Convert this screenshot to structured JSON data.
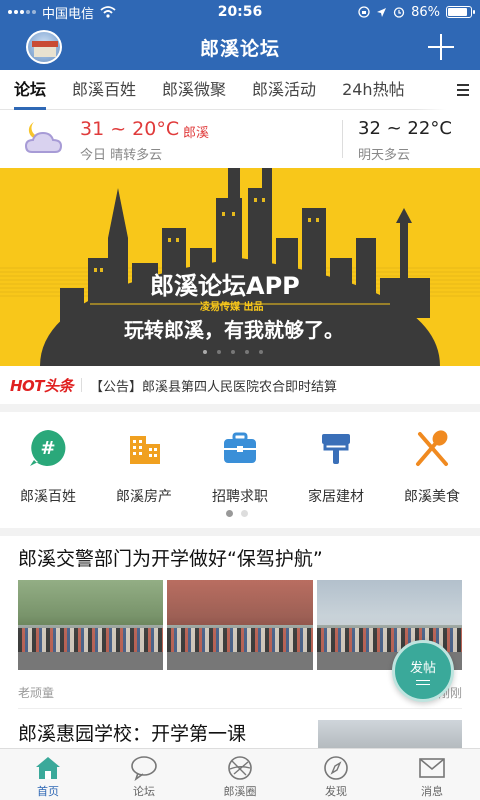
{
  "status_bar": {
    "carrier": "中国电信",
    "time": "20:56",
    "battery": "86%",
    "battery_level": 0.86
  },
  "header": {
    "title": "郎溪论坛"
  },
  "tabs": [
    "论坛",
    "郎溪百姓",
    "郎溪微聚",
    "郎溪活动",
    "24h热帖"
  ],
  "weather": {
    "today_temp": "31 ~ 20°C",
    "city": "郎溪",
    "today_desc": "今日 晴转多云",
    "tomorrow_temp": "32 ~ 22°C",
    "tomorrow_desc": "明天多云"
  },
  "banner": {
    "title": "郎溪论坛APP",
    "subtitle": "凌易传媒 出品",
    "slogan": "玩转郎溪，有我就够了。"
  },
  "headline": {
    "logo_text": "HOT头条",
    "text": "【公告】郎溪县第四人民医院农合即时结算"
  },
  "categories": [
    {
      "label": "郎溪百姓",
      "icon": "hashtag-icon",
      "color": "#2aa87a"
    },
    {
      "label": "郎溪房产",
      "icon": "building-icon",
      "color": "#f0a020"
    },
    {
      "label": "招聘求职",
      "icon": "briefcase-icon",
      "color": "#3a8fd8"
    },
    {
      "label": "家居建材",
      "icon": "brush-icon",
      "color": "#3a6fb8"
    },
    {
      "label": "郎溪美食",
      "icon": "utensils-icon",
      "color": "#f08a20"
    }
  ],
  "feed": {
    "post1": {
      "title": "郎溪交警部门为开学做好“保驾护航”",
      "author": "老顽童",
      "time": "刚刚"
    },
    "post2": {
      "title": "郎溪惠园学校：开学第一课"
    }
  },
  "fab": {
    "label": "发帖"
  },
  "bottom_nav": [
    {
      "label": "首页",
      "icon": "home-icon"
    },
    {
      "label": "论坛",
      "icon": "chat-bubble-icon"
    },
    {
      "label": "郎溪圈",
      "icon": "aperture-icon"
    },
    {
      "label": "发现",
      "icon": "compass-icon"
    },
    {
      "label": "消息",
      "icon": "envelope-icon"
    }
  ],
  "colors": {
    "brand_blue": "#2f68b5",
    "banner_yellow": "#f8c71a",
    "hot_red": "#e02020",
    "fab_green": "#3aa99a"
  }
}
